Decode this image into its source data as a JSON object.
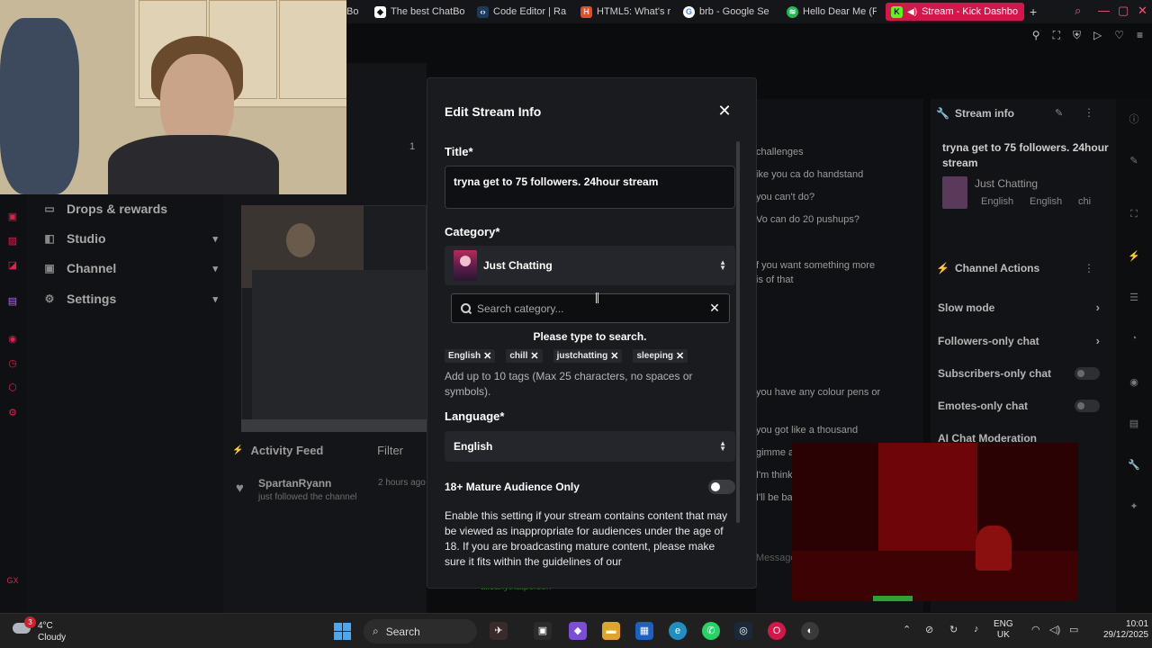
{
  "browser": {
    "tabs": [
      {
        "label": "Bo",
        "icon": "generic-tab-icon"
      },
      {
        "label": "The best ChatBo",
        "icon": "chatbot-tab-icon"
      },
      {
        "label": "Code Editor | Ra",
        "icon": "code-editor-tab-icon"
      },
      {
        "label": "HTML5: What's r",
        "icon": "html5-tab-icon"
      },
      {
        "label": "brb - Google Se",
        "icon": "google-tab-icon"
      },
      {
        "label": "Hello Dear Me (F",
        "icon": "spotify-tab-icon"
      },
      {
        "label": "Stream - Kick Dashbo",
        "icon": "kick-tab-icon",
        "active": true
      }
    ],
    "new_tab": "+"
  },
  "sidebar": {
    "items": [
      {
        "label": "Drops & rewards",
        "icon": "gift-icon"
      },
      {
        "label": "Studio",
        "icon": "studio-icon"
      },
      {
        "label": "Channel",
        "icon": "channel-icon"
      },
      {
        "label": "Settings",
        "icon": "gear-icon"
      }
    ]
  },
  "stream_preview": {
    "number": "1"
  },
  "activity": {
    "title": "Activity Feed",
    "filter": "Filter",
    "items": [
      {
        "name": "SpartanRyann",
        "action": "just followed the channel",
        "time": "2 hours ago"
      }
    ]
  },
  "chat": {
    "lines": [
      "challenges",
      "ike you ca do handstand",
      "you can't do?",
      "Vo can do 20 pushups?",
      "f you want something more",
      "is of that",
      "you have any colour pens or",
      "you got like a thousand",
      "gimme a",
      "I'm think",
      "I'll be ba",
      "Message"
    ],
    "footer": "ulicanythatperson"
  },
  "stream_info": {
    "title": "Stream info",
    "stream_title": "tryna get to 75 followers. 24hour stream",
    "category": "Just Chatting",
    "tags": [
      "English",
      "English",
      "chi"
    ]
  },
  "channel_actions": {
    "title": "Channel Actions",
    "items": [
      {
        "label": "Slow mode",
        "type": "arrow"
      },
      {
        "label": "Followers-only chat",
        "type": "arrow"
      },
      {
        "label": "Subscribers-only chat",
        "type": "toggle"
      },
      {
        "label": "Emotes-only chat",
        "type": "toggle"
      },
      {
        "label": "AI Chat Moderation",
        "type": "arrow"
      }
    ]
  },
  "modal": {
    "title": "Edit Stream Info",
    "close": "✕",
    "title_label": "Title*",
    "title_value": "tryna get to 75 followers. 24hour stream",
    "category_label": "Category*",
    "category_value": "Just Chatting",
    "search_placeholder": "Search category...",
    "search_clear": "✕",
    "search_hint": "Please type to search.",
    "tags": [
      "English",
      "chill",
      "justchatting",
      "sleeping"
    ],
    "tags_help": "Add up to 10 tags (Max 25 characters, no spaces or symbols).",
    "language_label": "Language*",
    "language_value": "English",
    "mature_label": "18+ Mature Audience Only",
    "mature_enabled": false,
    "mature_desc": "Enable this setting if your stream contains content that may be viewed as inappropriate for audiences under the age of 18. If you are broadcasting mature content, please make sure it fits within the guidelines of our"
  },
  "taskbar": {
    "weather_badge": "3",
    "temp": "4°C",
    "condition": "Cloudy",
    "search_label": "Search",
    "lang_line1": "ENG",
    "lang_line2": "UK",
    "time": "10:01",
    "date": "29/12/2025"
  },
  "colors": {
    "accent": "#d5164a",
    "modal_bg": "#191b1f",
    "kick_green": "#2fa32f"
  }
}
